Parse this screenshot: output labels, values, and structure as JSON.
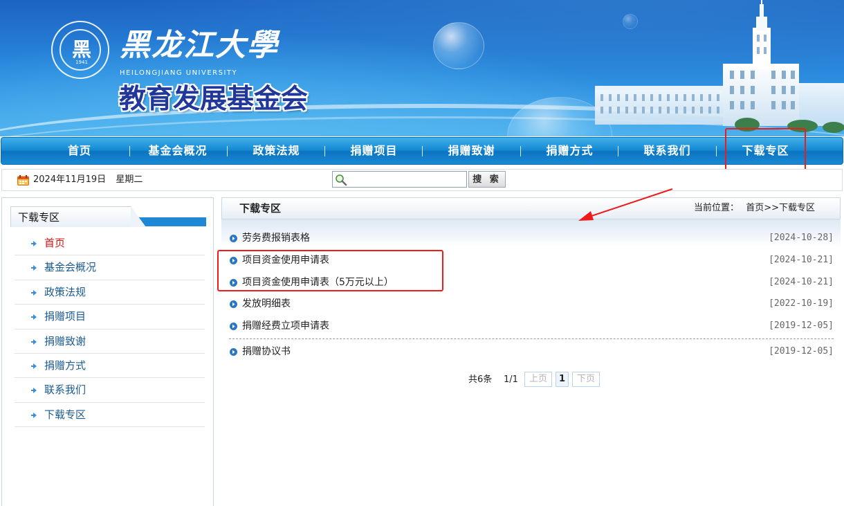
{
  "banner": {
    "university_name": "黑龙江大學",
    "university_en": "HEILONGJIANG UNIVERSITY",
    "foundation_name": "教育发展基金会",
    "seal_year": "1941"
  },
  "nav": {
    "items": [
      "首页",
      "基金会概况",
      "政策法规",
      "捐赠项目",
      "捐赠致谢",
      "捐赠方式",
      "联系我们",
      "下载专区"
    ]
  },
  "info": {
    "date": "2024年11月19日",
    "weekday": "星期二",
    "search_value": "",
    "search_button": "搜 索"
  },
  "sidebar": {
    "title": "下载专区",
    "items": [
      "首页",
      "基金会概况",
      "政策法规",
      "捐赠项目",
      "捐赠致谢",
      "捐赠方式",
      "联系我们",
      "下载专区"
    ]
  },
  "main": {
    "title": "下载专区",
    "breadcrumb_label": "当前位置：",
    "breadcrumb_path": "首页>>下载专区",
    "files": [
      {
        "title": "劳务费报销表格",
        "date": "[2024-10-28]"
      },
      {
        "title": "项目资金使用申请表",
        "date": "[2024-10-21]"
      },
      {
        "title": "项目资金使用申请表（5万元以上）",
        "date": "[2024-10-21]"
      },
      {
        "title": "发放明细表",
        "date": "[2022-10-19]"
      },
      {
        "title": "捐赠经费立项申请表",
        "date": "[2019-12-05]"
      },
      {
        "title": "捐赠协议书",
        "date": "[2019-12-05]"
      }
    ],
    "pager": {
      "total": "共6条",
      "pages": "1/1",
      "prev": "上页",
      "current": "1",
      "next": "下页"
    }
  },
  "colors": {
    "annotation_red": "#ef1a1a",
    "nav_blue": "#1487d2",
    "active_red": "#d21414"
  }
}
